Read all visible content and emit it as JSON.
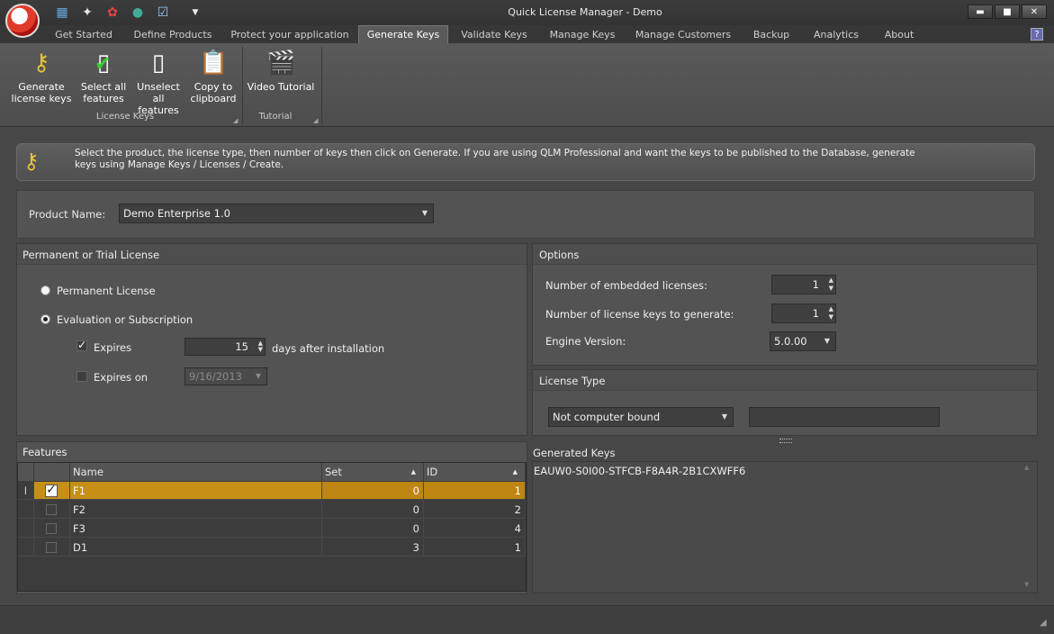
{
  "window": {
    "title": "Quick License Manager - Demo",
    "minimize": "▬",
    "maximize": "■",
    "close": "✕"
  },
  "tabs": [
    {
      "label": "Get Started"
    },
    {
      "label": "Define Products"
    },
    {
      "label": "Protect your application"
    },
    {
      "label": "Generate Keys",
      "active": true
    },
    {
      "label": "Validate Keys"
    },
    {
      "label": "Manage Keys"
    },
    {
      "label": "Manage Customers"
    },
    {
      "label": "Backup"
    },
    {
      "label": "Analytics"
    },
    {
      "label": "About"
    }
  ],
  "ribbon": {
    "buttons": {
      "generate": "Generate license keys",
      "select_all": "Select all features",
      "unselect_all": "Unselect all features",
      "copy": "Copy to clipboard",
      "video": "Video Tutorial"
    },
    "groups": {
      "license_keys": "License Keys",
      "tutorial": "Tutorial"
    }
  },
  "info": {
    "text": "Select the product, the license type, then number of keys then click on Generate. If you are using QLM Professional and want the keys to be published to the Database, generate keys using Manage Keys / Licenses / Create."
  },
  "product": {
    "label": "Product Name:",
    "value": "Demo Enterprise 1.0"
  },
  "license_mode": {
    "title": "Permanent or Trial License",
    "permanent": "Permanent License",
    "evaluation": "Evaluation or Subscription",
    "selected": "evaluation",
    "expires_label": "Expires",
    "expires_checked": true,
    "expires_days": "15",
    "days_after": "days after installation",
    "expires_on_label": "Expires on",
    "expires_on_checked": false,
    "expires_on_date": "9/16/2013"
  },
  "options": {
    "title": "Options",
    "embedded_label": "Number of embedded licenses:",
    "embedded_value": "1",
    "keys_label": "Number of license keys to generate:",
    "keys_value": "1",
    "engine_label": "Engine Version:",
    "engine_value": "5.0.00"
  },
  "license_type": {
    "title": "License Type",
    "value": "Not computer bound",
    "extra_value": ""
  },
  "features": {
    "title": "Features",
    "columns": {
      "name": "Name",
      "set": "Set",
      "id": "ID"
    },
    "rows": [
      {
        "checked": true,
        "name": "F1",
        "set": "0",
        "id": "1",
        "selected": true
      },
      {
        "checked": false,
        "name": "F2",
        "set": "0",
        "id": "2"
      },
      {
        "checked": false,
        "name": "F3",
        "set": "0",
        "id": "4"
      },
      {
        "checked": false,
        "name": "D1",
        "set": "3",
        "id": "1"
      }
    ],
    "row_cursor": "I"
  },
  "generated": {
    "title": "Generated Keys",
    "keys": "EAUW0-S0I00-STFCB-F8A4R-2B1CXWFF6"
  },
  "icons": {
    "key": "key-icon",
    "check_doc": "check-document-icon",
    "blank_doc": "blank-document-icon",
    "clipboard": "clipboard-icon",
    "film": "film-reel-icon"
  }
}
